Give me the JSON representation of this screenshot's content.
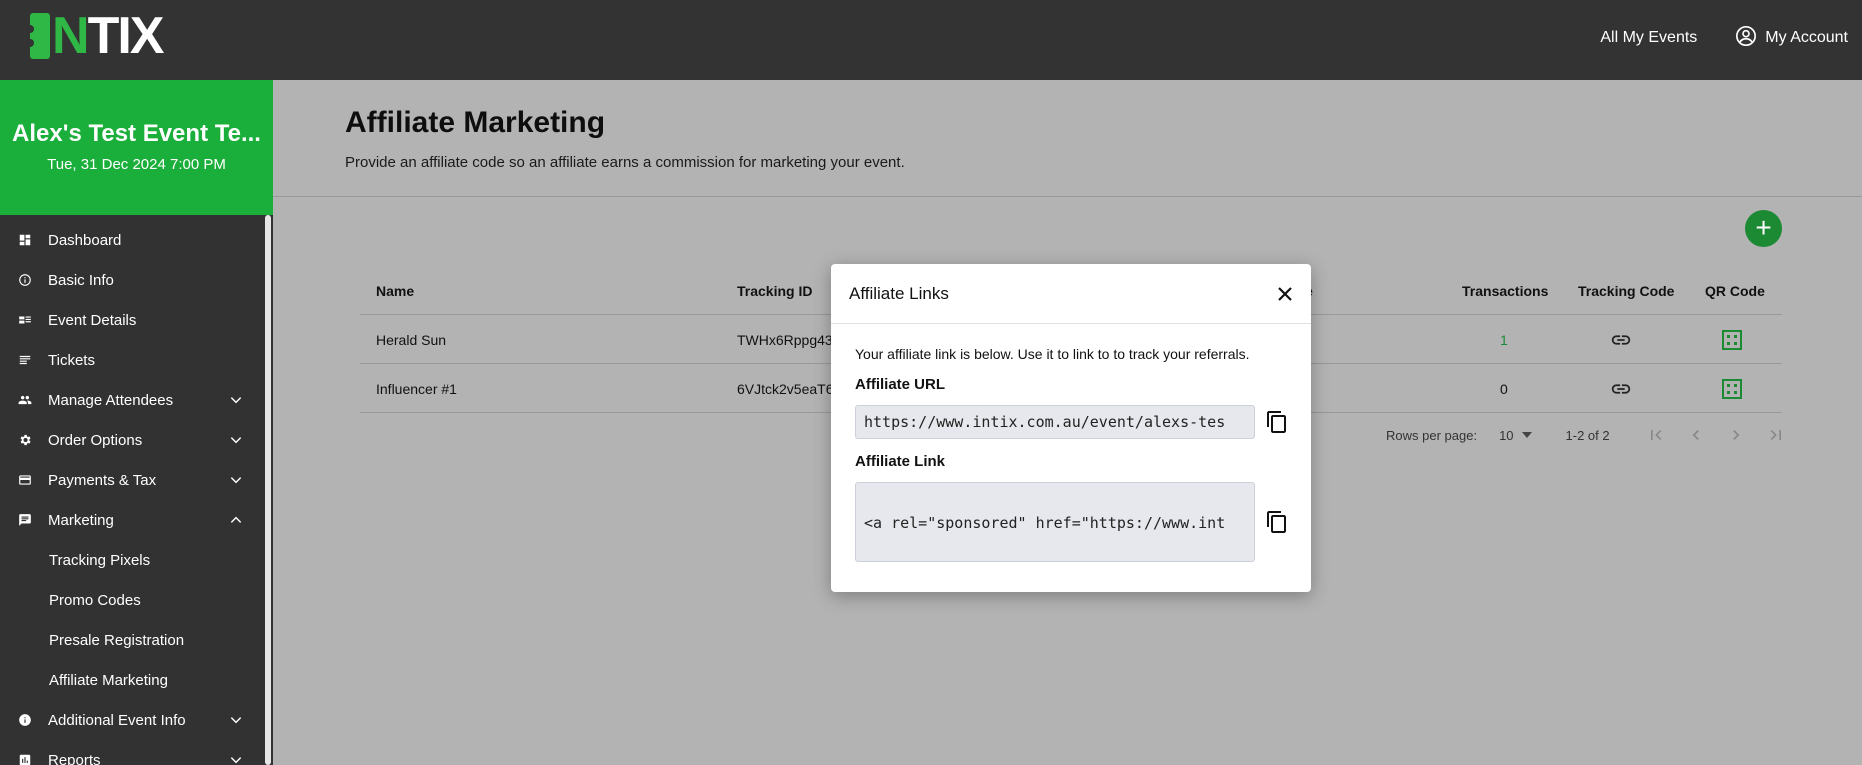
{
  "header": {
    "logo_prefix": "I",
    "logo_accent": "N",
    "logo_suffix": "TIX",
    "nav": [
      {
        "label": "All My Events"
      },
      {
        "label": "My Account",
        "icon": "account-circle-icon"
      }
    ]
  },
  "event": {
    "title": "Alex's Test Event Te...",
    "date": "Tue, 31 Dec 2024 7:00 PM"
  },
  "sidebar": {
    "items": [
      {
        "label": "Dashboard",
        "icon": "dashboard-icon"
      },
      {
        "label": "Basic Info",
        "icon": "info-icon"
      },
      {
        "label": "Event Details",
        "icon": "event-details-icon"
      },
      {
        "label": "Tickets",
        "icon": "tickets-icon"
      },
      {
        "label": "Manage Attendees",
        "icon": "people-icon",
        "expand": "down"
      },
      {
        "label": "Order Options",
        "icon": "gear-icon",
        "expand": "down"
      },
      {
        "label": "Payments & Tax",
        "icon": "credit-card-icon",
        "expand": "down"
      },
      {
        "label": "Marketing",
        "icon": "chat-icon",
        "expand": "up"
      },
      {
        "label": "Tracking Pixels",
        "sub": true
      },
      {
        "label": "Promo Codes",
        "sub": true
      },
      {
        "label": "Presale Registration",
        "sub": true
      },
      {
        "label": "Affiliate Marketing",
        "sub": true
      },
      {
        "label": "Additional Event Info",
        "icon": "info-filled-icon",
        "expand": "down"
      },
      {
        "label": "Reports",
        "icon": "bar-chart-icon",
        "expand": "down"
      }
    ]
  },
  "page": {
    "title": "Affiliate Marketing",
    "subtitle": "Provide an affiliate code so an affiliate earns a commission for marketing your event."
  },
  "table": {
    "headers": {
      "name": "Name",
      "tracking_id": "Tracking ID",
      "partial": "e",
      "transactions": "Transactions",
      "tracking_code": "Tracking Code",
      "qr_code": "QR Code"
    },
    "rows": [
      {
        "name": "Herald Sun",
        "tracking_id": "TWHx6Rppg43Y",
        "transactions": "1"
      },
      {
        "name": "Influencer #1",
        "tracking_id": "6VJtck2v5eaT6",
        "transactions": "0"
      }
    ],
    "rows_per_page_label": "Rows per page:",
    "rows_per_page": "10",
    "range": "1-2 of 2"
  },
  "modal": {
    "title": "Affiliate Links",
    "description": "Your affiliate link is below. Use it to link to to track your referrals.",
    "url_label": "Affiliate URL",
    "url_value": "https://www.intix.com.au/event/alexs-tes",
    "link_label": "Affiliate Link",
    "link_value": "<a rel=\"sponsored\" href=\"https://www.int"
  },
  "colors": {
    "brand_green": "#1aae3a",
    "action_green": "#1b8a33",
    "header_bg": "#333333"
  }
}
